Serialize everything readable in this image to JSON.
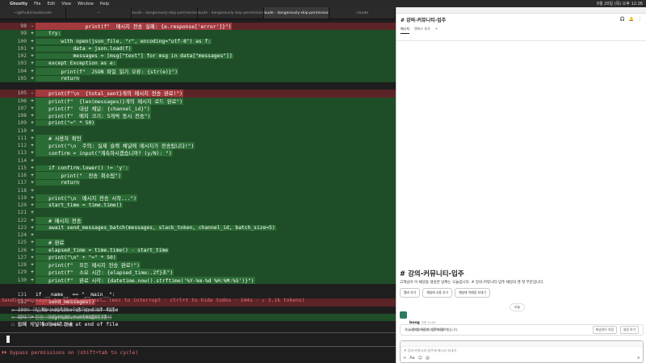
{
  "menubar": {
    "app": "Ghostty",
    "items": [
      "File",
      "Edit",
      "View",
      "Window",
      "Help"
    ],
    "status": "9월 20일 (목) 오후 12:26"
  },
  "terminal_tabs": [
    {
      "label": "~/github/claudecode",
      "active": false
    },
    {
      "label": "~",
      "active": false
    },
    {
      "label": "claude - dangerously-skip-permissions",
      "active": false
    },
    {
      "label": "claude - dangerously-skip-permissions",
      "active": false
    },
    {
      "label": "claude - dangerously-skip-permissions",
      "active": true
    },
    {
      "label": "claude",
      "active": false
    }
  ],
  "diff_lines": [
    {
      "num": "98",
      "sign": "-",
      "code": "                print(f\"  메시지 전송 실패: {e.response['error']}\")",
      "kind": "del"
    },
    {
      "num": "99",
      "sign": "+",
      "code": "    try:",
      "kind": "add"
    },
    {
      "num": "100",
      "sign": "+",
      "code": "        with open(json_file, \"r\", encoding=\"utf-8\") as f:",
      "kind": "add"
    },
    {
      "num": "101",
      "sign": "+",
      "code": "            data = json.load(f)",
      "kind": "add"
    },
    {
      "num": "102",
      "sign": "+",
      "code": "            messages = [msg[\"text\"] for msg in data[\"messages\"]]",
      "kind": "add"
    },
    {
      "num": "103",
      "sign": "+",
      "code": "    except Exception as e:",
      "kind": "add"
    },
    {
      "num": "104",
      "sign": "+",
      "code": "        print(f\"  JSON 파일 읽기 오류: {str(e)}\")",
      "kind": "add"
    },
    {
      "num": "105",
      "sign": "+",
      "code": "        return",
      "kind": "add"
    },
    {
      "num": "",
      "sign": "",
      "code": "",
      "kind": "ctx"
    },
    {
      "num": "105",
      "sign": "-",
      "code": "    print(f\"\\n  {total_sent}개의 메시지 전송 완료!\")",
      "kind": "del"
    },
    {
      "num": "106",
      "sign": "+",
      "code": "    print(f\"  {len(messages)}개의 메시지 로드 완료\")",
      "kind": "add"
    },
    {
      "num": "107",
      "sign": "+",
      "code": "    print(f\"  대상 채널: {channel_id}\")",
      "kind": "add"
    },
    {
      "num": "108",
      "sign": "+",
      "code": "    print(f\"  배치 크기: 5개씩 동시 전송\")",
      "kind": "add"
    },
    {
      "num": "109",
      "sign": "+",
      "code": "    print(\"=\" * 50)",
      "kind": "add"
    },
    {
      "num": "110",
      "sign": "+",
      "code": "",
      "kind": "add"
    },
    {
      "num": "111",
      "sign": "+",
      "code": "    # 사용자 확인",
      "kind": "add"
    },
    {
      "num": "112",
      "sign": "+",
      "code": "    print(\"\\n  주의: 실제 슬랙 채널에 메시지가 전송됩니다!\")",
      "kind": "add"
    },
    {
      "num": "113",
      "sign": "+",
      "code": "    confirm = input(\"계속하시겠습니까? (y/N): \")",
      "kind": "add"
    },
    {
      "num": "114",
      "sign": "+",
      "code": "",
      "kind": "add"
    },
    {
      "num": "115",
      "sign": "+",
      "code": "    if confirm.lower() != 'y':",
      "kind": "add"
    },
    {
      "num": "116",
      "sign": "+",
      "code": "        print(\"  전송 취소됨\")",
      "kind": "add"
    },
    {
      "num": "117",
      "sign": "+",
      "code": "        return",
      "kind": "add"
    },
    {
      "num": "118",
      "sign": "+",
      "code": "",
      "kind": "add"
    },
    {
      "num": "119",
      "sign": "+",
      "code": "    print(\"\\n  메시지 전송 시작...\")",
      "kind": "add"
    },
    {
      "num": "120",
      "sign": "+",
      "code": "    start_time = time.time()",
      "kind": "add"
    },
    {
      "num": "121",
      "sign": "+",
      "code": "",
      "kind": "add"
    },
    {
      "num": "122",
      "sign": "+",
      "code": "    # 메시지 전송",
      "kind": "add"
    },
    {
      "num": "123",
      "sign": "+",
      "code": "    await send_messages_batch(messages, slack_token, channel_id, batch_size=5)",
      "kind": "add"
    },
    {
      "num": "124",
      "sign": "+",
      "code": "",
      "kind": "add"
    },
    {
      "num": "125",
      "sign": "+",
      "code": "    # 완료",
      "kind": "add"
    },
    {
      "num": "126",
      "sign": "+",
      "code": "    elapsed_time = time.time() - start_time",
      "kind": "add"
    },
    {
      "num": "127",
      "sign": "+",
      "code": "    print(\"\\n\" + \"=\" * 50)",
      "kind": "add"
    },
    {
      "num": "128",
      "sign": "+",
      "code": "    print(f\"  모든 메시지 전송 완료!\")",
      "kind": "add"
    },
    {
      "num": "129",
      "sign": "+",
      "code": "    print(f\"  소요 시간: {elapsed_time:.2f}초\")",
      "kind": "add"
    },
    {
      "num": "130",
      "sign": "+",
      "code": "    print(f\"  완료 시각: {datetime.now().strftime('%Y-%m-%d %H:%M:%S')}\")",
      "kind": "add"
    },
    {
      "num": "",
      "sign": "",
      "code": "",
      "kind": "ctx"
    },
    {
      "num": "131",
      "sign": "",
      "code": "if __name__ == \"__main__\":",
      "kind": "ctx"
    },
    {
      "num": "132",
      "sign": "-",
      "code": "    send_messages()",
      "kind": "del"
    },
    {
      "num": "133",
      "sign": "",
      "code": "\\ No newline at end of file",
      "kind": "ctx"
    },
    {
      "num": "133",
      "sign": "+",
      "code": "    asyncio.run(main())",
      "kind": "add"
    },
    {
      "num": "134",
      "sign": "",
      "code": "\\ No newline at end of file",
      "kind": "ctx"
    }
  ],
  "status_line": "Sending messages to Slack channel… (esc to interrupt · ctrl+t to hide todos · 144s · ↓ 3.1k tokens)",
  "todos": [
    "☒ JSON 파일에서 메시지 추출하는 코드 작성",
    "☒ 메시지 전송 로직 Python 스크립트 작성",
    "☐ 슬랙 채널에 메시지 전송"
  ],
  "bypass_line": "⏵⏵ bypass permissions on (shift+tab to cycle)",
  "slack": {
    "channel_title": "# 강의-커뮤니티-입주",
    "tabs": [
      "메시지",
      "캔버스 추가",
      "+"
    ],
    "header_icons": [
      "huddle-icon",
      "bell-icon",
      "more-icon"
    ],
    "intro_title": "# 강의-커뮤니티-입주",
    "intro_desc": "고객님이 이 채널을 생성한 날짜는 오늘입니다. # 강의-커뮤니티-입주 채널의 맨 첫 부분입니다.",
    "intro_buttons": [
      "멤버 추가",
      "채널에 사용 추가",
      "채널에 이메일 보내기"
    ],
    "today_label": "오늘",
    "message": {
      "author": "bong",
      "time": "오후 12:04",
      "body": "#강의-커뮤니티-입주에 참여했습니다."
    },
    "banner": {
      "text": "채널 관리를 사용자 지정하세요.",
      "btn1": "채널관리 지정",
      "btn2": "설정 보기"
    },
    "composer_placeholder": "# 강의-커뮤니티-입주에 메시지 보내기"
  }
}
